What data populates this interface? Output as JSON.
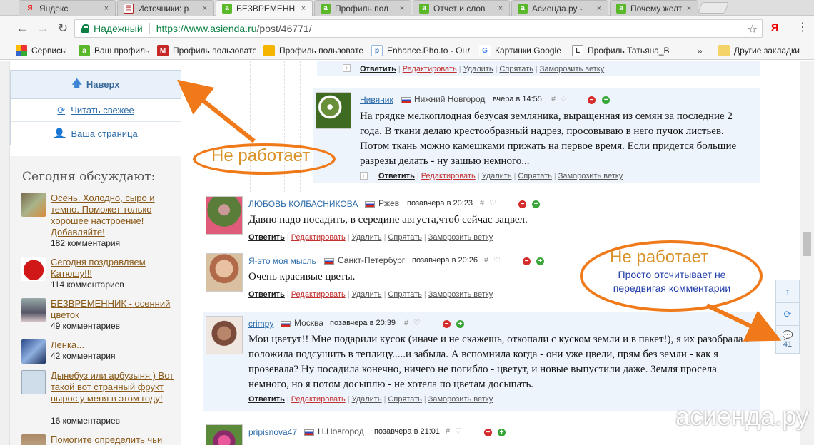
{
  "tabs": [
    {
      "title": "Яндекс",
      "close": "×",
      "fav_color": "#ffffff",
      "fav_glyph": "Я",
      "active": false
    },
    {
      "title": "Источники: р",
      "close": "×",
      "fav_color": "#b22222",
      "fav_glyph": "▤",
      "active": false
    },
    {
      "title": "БЕЗВРЕМЕНН",
      "close": "×",
      "fav_color": "#5bb82a",
      "fav_glyph": "a",
      "active": true
    },
    {
      "title": "Профиль пол",
      "close": "×",
      "fav_color": "#5bb82a",
      "fav_glyph": "a",
      "active": false
    },
    {
      "title": "Отчет и слов",
      "close": "×",
      "fav_color": "#5bb82a",
      "fav_glyph": "a",
      "active": false
    },
    {
      "title": "Асиенда.ру -",
      "close": "×",
      "fav_color": "#5bb82a",
      "fav_glyph": "a",
      "active": false
    },
    {
      "title": "Почему желт",
      "close": "×",
      "fav_color": "#5bb82a",
      "fav_glyph": "a",
      "active": false
    }
  ],
  "toolbar": {
    "back": "←",
    "forward": "→",
    "reload": "↻",
    "secure_label": "Надежный",
    "url_host": "https://www.asienda.ru",
    "url_path": "/post/46771/",
    "star": "☆",
    "ext": "Я",
    "menu": "⋮"
  },
  "bookmarks": [
    {
      "label": "Сервисы",
      "icon": "apps-icon"
    },
    {
      "label": "Ваш профиль",
      "icon": "asienda-icon"
    },
    {
      "label": "Профиль пользовате",
      "icon": "m-icon"
    },
    {
      "label": "Профиль пользовате",
      "icon": "yellow-icon"
    },
    {
      "label": "Enhance.Pho.to - Онл",
      "icon": "pho-icon"
    },
    {
      "label": "Картинки Google",
      "icon": "google-icon"
    },
    {
      "label": "Профиль Татьяна_Ве",
      "icon": "lv-icon"
    },
    {
      "label": "»",
      "icon": ""
    },
    {
      "label": "Другие закладки",
      "icon": "folder-icon"
    }
  ],
  "sidenav": {
    "top": "Наверх",
    "fresh": "Читать свежее",
    "mypage": "Ваша страница"
  },
  "today": {
    "title": "Сегодня обсуждают:",
    "items": [
      {
        "title": "Осень. Холодно, сыро и темно. Поможет только хорошее настроение! Добавляйте!",
        "count": "182 комментария"
      },
      {
        "title": "Сегодня поздравляем Катюшу!!!",
        "count": "114 комментариев"
      },
      {
        "title": "БЕЗВРЕМЕННИК - осенний цветок",
        "count": "49 комментариев"
      },
      {
        "title": "Ленка...",
        "count": "42 комментария"
      },
      {
        "title": "Дынебуз или арбузыня ) Вот такой вот странный фрукт вырос у меня в этом году!",
        "count": "16 комментариев"
      },
      {
        "title": "Помогите определить чьи",
        "count": ""
      }
    ]
  },
  "actions": {
    "reply": "Ответить",
    "edit": "Редактировать",
    "delete": "Удалить",
    "hide": "Спрятать",
    "freeze": "Заморозить ветку"
  },
  "comments": [
    {
      "author": "Нивяник",
      "city": "Нижний Новгород",
      "when": "вчера в 14:55",
      "text": "На грядке мелкоплодная безусая земляника, выращенная из семян за последние 2 года. В ткани делаю крестообразный надрез, просовываю в него пучок листьев. Потом ткань можно камешками прижать на первое время. Если придется большие разрезы делать - ну зашью немного..."
    },
    {
      "author": "ЛЮБОВЬ КОЛБАСНИКОВА",
      "city": "Ржев",
      "when": "позавчера в 20:23",
      "text": "Давно надо посадить, в середине августа,чтоб сейчас зацвел."
    },
    {
      "author": "Я-это моя мысль",
      "city": "Санкт-Петербург",
      "when": "позавчера в 20:26",
      "text": "Очень красивые цветы."
    },
    {
      "author": "crimpy",
      "city": "Москва",
      "when": "позавчера в 20:39",
      "text": "Мои цветут!! Мне подарили кусок (иначе и не скажешь, откопали с куском земли и в пакет!), я их разобрала и положила подсушить в теплицу.....и забыла. А вспомнила когда - они уже цвели, прям без земли - как я прозевала? Ну посадила конечно, ничего не погибло - цветут, и новые выпустили даже. Земля просела немного, но я потом досыплю - не хотела по цветам досыпать."
    },
    {
      "author": "pripisnova47",
      "city": "Н.Новгород",
      "when": "позавчера в 21:01",
      "text": ""
    }
  ],
  "meta_marks": {
    "hash": "#",
    "heart": "♡",
    "minus": "−",
    "plus": "+"
  },
  "float_widget": {
    "up": "↑",
    "refresh": "⟳",
    "comments": "41"
  },
  "annotations": {
    "left": "Не работает",
    "right": "Не работает",
    "right_sub": "Просто отсчитывает не передвигая комментарии"
  },
  "watermark": "асиенда.ру",
  "colors": {
    "accent_orange": "#f07a1a",
    "link_blue": "#2a6aa8",
    "highlight": "#eef4fc",
    "secure_green": "#0b8043"
  }
}
